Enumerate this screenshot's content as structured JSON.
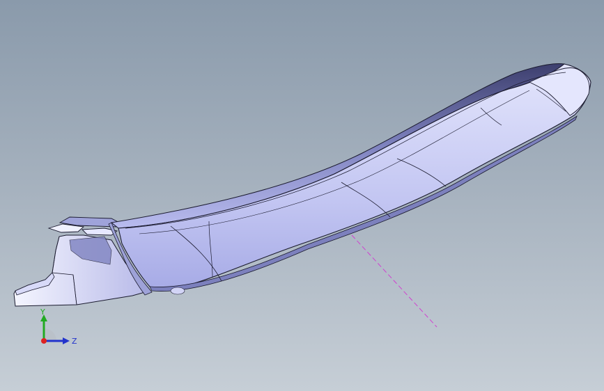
{
  "viewport": {
    "background_top": "#8a9aab",
    "background_bottom": "#c6ced6"
  },
  "model": {
    "face_color": "#c9cbf4",
    "shade_color": "#6b6fa8",
    "edge_color": "#1a1a2e",
    "centerline_color": "#d040d0"
  },
  "triad": {
    "y_label": "Y",
    "z_label": "Z",
    "y_color": "#22aa22",
    "z_color": "#2233cc",
    "origin_color": "#dd2222"
  }
}
